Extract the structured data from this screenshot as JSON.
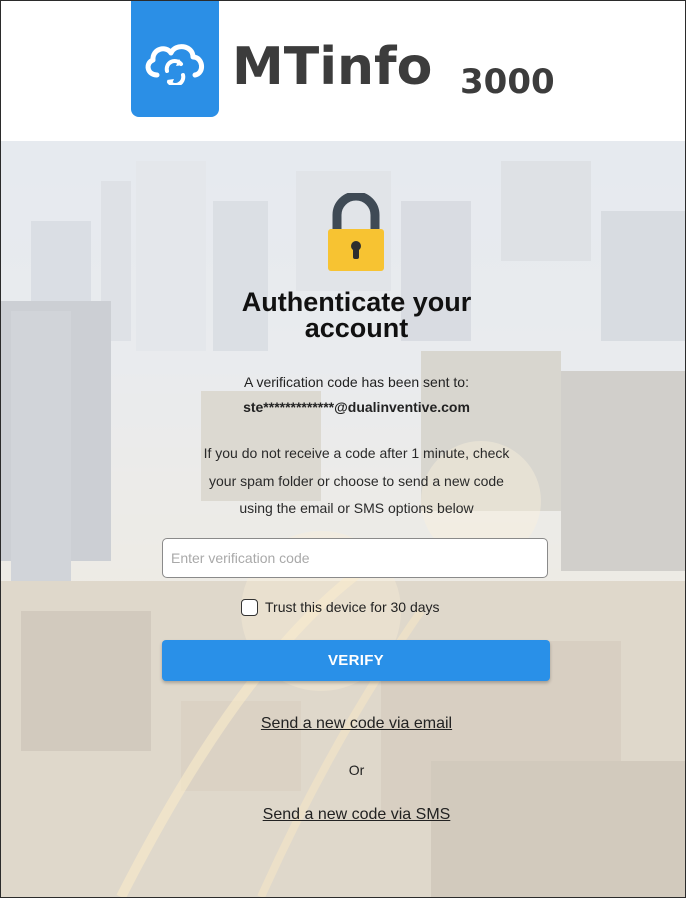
{
  "header": {
    "brand_name": "MTinfo",
    "brand_number": "3000",
    "logo_icon": "cloud-sync-icon"
  },
  "auth": {
    "lock_icon": "padlock-icon",
    "title_line1": "Authenticate your",
    "title_line2": "account",
    "sent_to_label": "A verification code has been sent to:",
    "masked_email": "ste*************@dualinventive.com",
    "help_line1": "If you do not receive a code after 1 minute, check",
    "help_line2": "your spam folder or choose to send a new code",
    "help_line3": "using the email or SMS options below",
    "code_placeholder": "Enter verification code",
    "code_value": "",
    "trust_label": "Trust this device for 30 days",
    "trust_checked": false,
    "verify_label": "VERIFY",
    "email_link": "Send a new code via email",
    "or_label": "Or",
    "sms_link": "Send a new code via SMS"
  },
  "colors": {
    "brand_blue": "#2b8fe6",
    "button_blue": "#2990e8",
    "lock_gold": "#f7c332",
    "lock_shackle": "#3f4a55"
  }
}
